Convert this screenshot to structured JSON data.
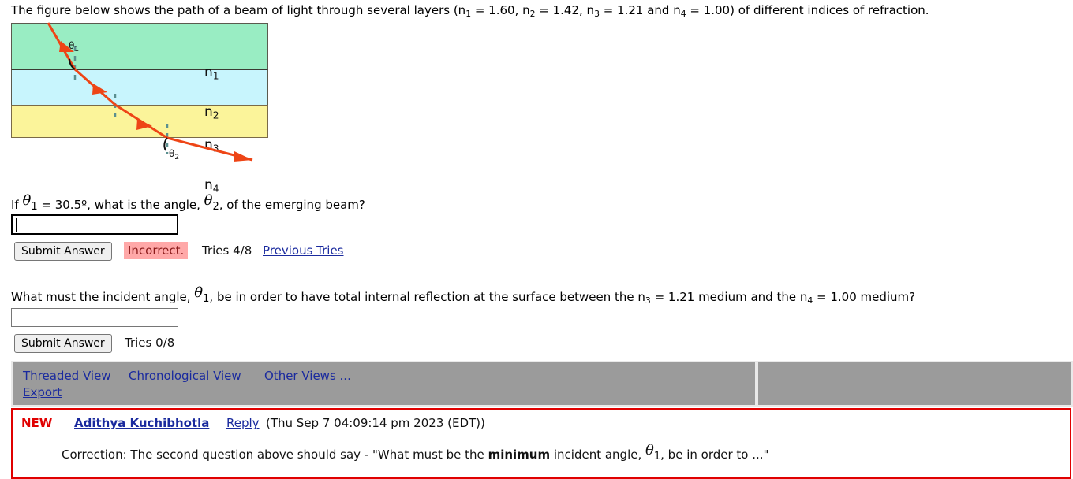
{
  "problem": {
    "intro_pre": "The figure below shows the path of a beam of light through several layers (n",
    "intro_vals": [
      {
        "sub": "1",
        "value": " = 1.60, "
      },
      {
        "sub": "2",
        "value": " = 1.42, "
      },
      {
        "sub": "3",
        "value": " = 1.21 and "
      },
      {
        "sub": "4",
        "value": " = 1.00) of different indices of refraction."
      }
    ],
    "intro_full": "The figure below shows the path of a beam of light through several layers (n1 = 1.60, n2 = 1.42, n3 = 1.21 and n4 = 1.00) of different indices of refraction."
  },
  "figure": {
    "name": "light-refraction-layers-diagram",
    "labels": {
      "n1": "n",
      "n1_sub": "1",
      "n2": "n",
      "n2_sub": "2",
      "n3": "n",
      "n3_sub": "3",
      "n4": "n",
      "n4_sub": "4",
      "theta1": "θ",
      "theta1_sub": "1",
      "theta2": "θ",
      "theta2_sub": "2"
    },
    "colors": {
      "layer1": "#99edc3",
      "layer2": "#c8f5fd",
      "layer3": "#fbf49a",
      "beam": "#ee4516",
      "normal_dash": "#5a8f8f",
      "border": "#5a5a4e"
    }
  },
  "question1": {
    "prefix": "If ",
    "theta": "θ",
    "theta_sub": "1",
    "mid": " = 30.5º, what is the angle, ",
    "theta2": "θ",
    "theta2_sub": "2",
    "suffix": ", of the emerging beam?",
    "input_value": "",
    "submit_label": "Submit Answer",
    "feedback": "Incorrect.",
    "feedback_bg": "#ffa8a8",
    "feedback_color": "#8b1a1a",
    "tries": "Tries 4/8",
    "previous_tries_label": "Previous Tries"
  },
  "question2": {
    "prefix": "What must the incident angle, ",
    "theta": "θ",
    "theta_sub": "1",
    "suffix": ", be in order to have total internal reflection at the surface between the n",
    "suffix_sub1": "3",
    "suffix_mid": " = 1.21 medium and the n",
    "suffix_sub2": "4",
    "suffix_end": " = 1.00 medium?",
    "input_value": "",
    "submit_label": "Submit Answer",
    "tries": "Tries 0/8"
  },
  "discussion": {
    "toolbar": {
      "threaded_view": "Threaded View",
      "chronological_view": "Chronological View",
      "other_views": "Other Views ...",
      "export": "Export"
    },
    "post": {
      "new_badge": "NEW",
      "author": "Adithya Kuchibhotla",
      "reply_label": "Reply",
      "timestamp": "(Thu Sep 7 04:09:14 pm 2023 (EDT))",
      "body_pre": "Correction: The second question above should say - \"What must be the ",
      "body_bold": "minimum",
      "body_mid": " incident angle, ",
      "body_theta": "θ",
      "body_theta_sub": "1",
      "body_post": ", be in order to ...\"",
      "border_color": "#e00000"
    }
  }
}
